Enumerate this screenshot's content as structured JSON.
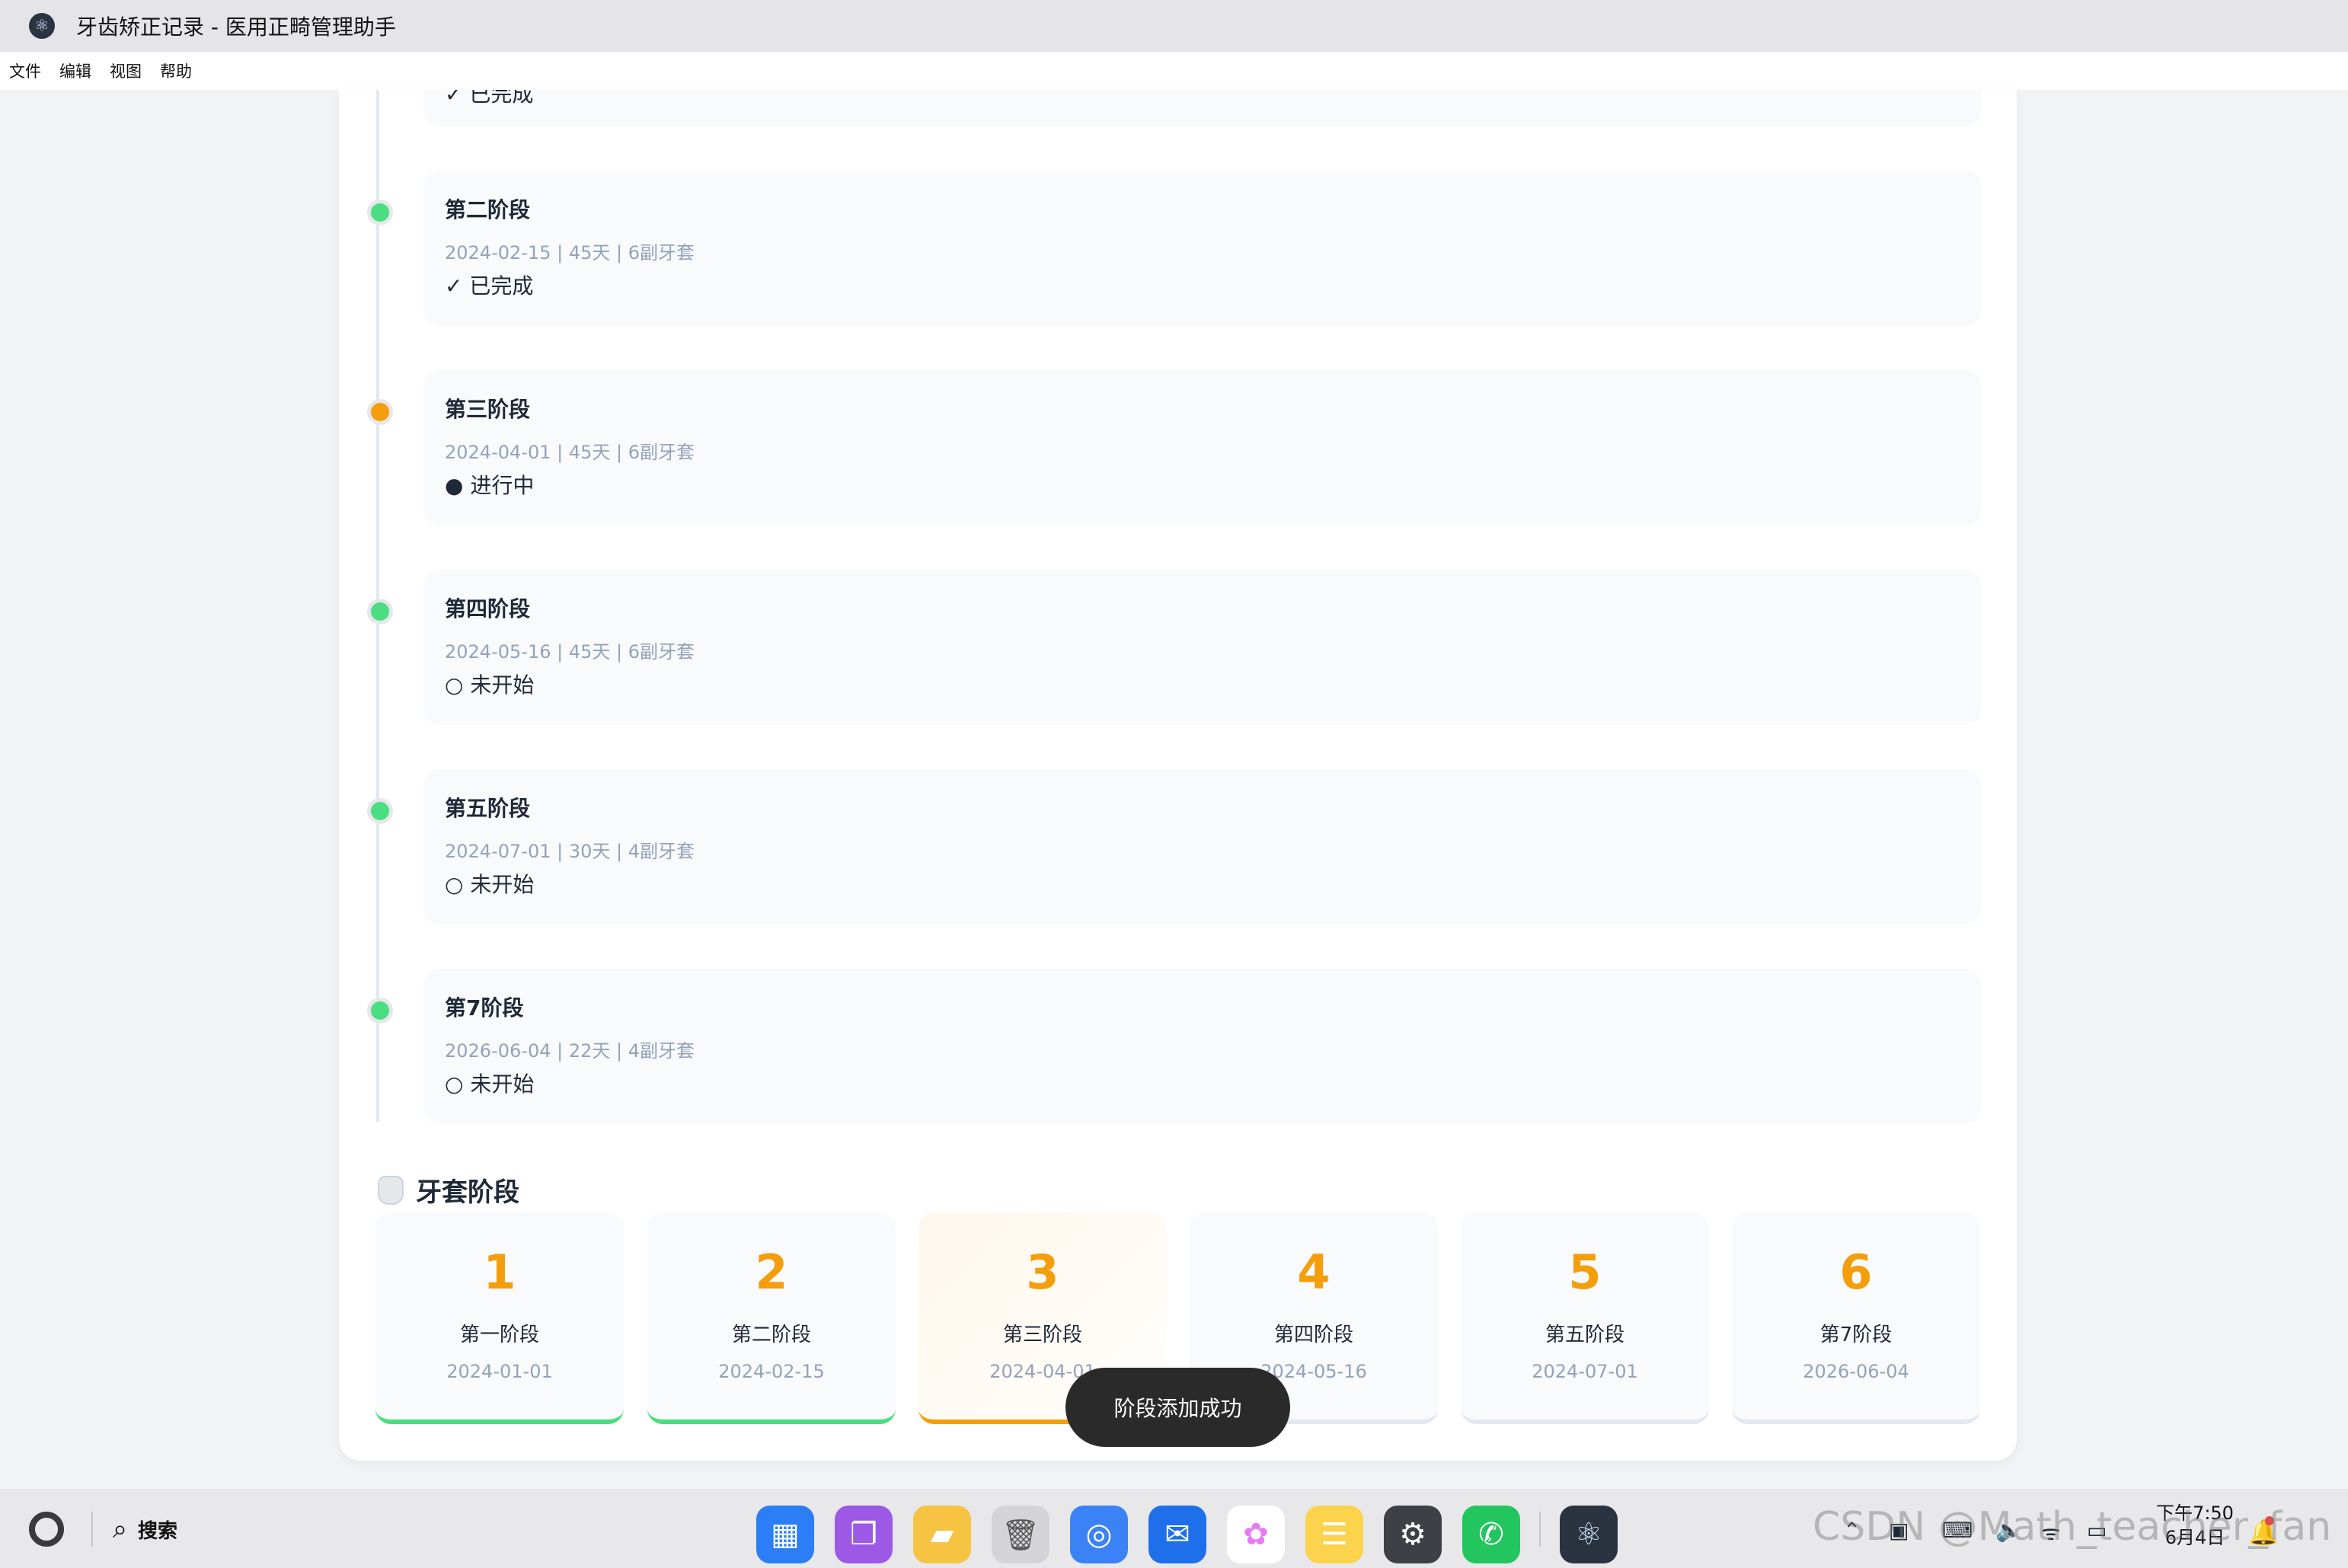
{
  "window": {
    "title": "牙齿矫正记录 - 医用正畸管理助手"
  },
  "menu": [
    "文件",
    "编辑",
    "视图",
    "帮助"
  ],
  "timeline": {
    "partial_status": "✓ 已完成",
    "stages": [
      {
        "name": "第二阶段",
        "meta": "2024-02-15 | 45天 | 6副牙套",
        "status": "✓ 已完成",
        "state": "done"
      },
      {
        "name": "第三阶段",
        "meta": "2024-04-01 | 45天 | 6副牙套",
        "status": "● 进行中",
        "state": "active"
      },
      {
        "name": "第四阶段",
        "meta": "2024-05-16 | 45天 | 6副牙套",
        "status": "○ 未开始",
        "state": "pending"
      },
      {
        "name": "第五阶段",
        "meta": "2024-07-01 | 30天 | 4副牙套",
        "status": "○ 未开始",
        "state": "pending"
      },
      {
        "name": "第7阶段",
        "meta": "2026-06-04 | 22天 | 4副牙套",
        "status": "○ 未开始",
        "state": "pending"
      }
    ]
  },
  "aligners": {
    "title": "牙套阶段",
    "items": [
      {
        "num": "1",
        "name": "第一阶段",
        "date": "2024-01-01",
        "state": "done"
      },
      {
        "num": "2",
        "name": "第二阶段",
        "date": "2024-02-15",
        "state": "done"
      },
      {
        "num": "3",
        "name": "第三阶段",
        "date": "2024-04-01",
        "state": "current"
      },
      {
        "num": "4",
        "name": "第四阶段",
        "date": "2024-05-16",
        "state": "pending"
      },
      {
        "num": "5",
        "name": "第五阶段",
        "date": "2024-07-01",
        "state": "pending"
      },
      {
        "num": "6",
        "name": "第7阶段",
        "date": "2026-06-04",
        "state": "pending"
      }
    ]
  },
  "toast": "阶段添加成功",
  "taskbar": {
    "search_label": "搜索",
    "clock_time": "下午7:50",
    "clock_date": "6月4日",
    "watermark": "CSDN @Math_teacher_fan"
  },
  "colors": {
    "done": "#4ade80",
    "active": "#f59e0b",
    "accent": "#f59e0b"
  }
}
